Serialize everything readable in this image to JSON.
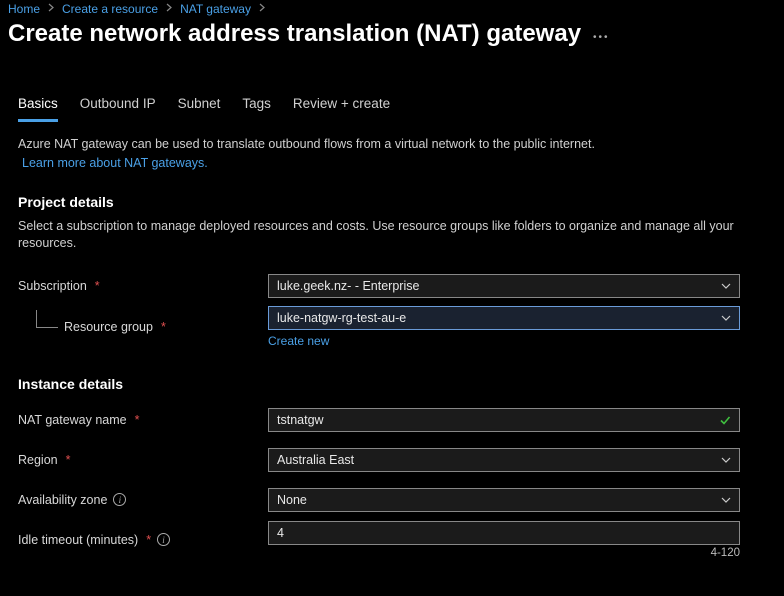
{
  "breadcrumb": {
    "home": "Home",
    "create": "Create a resource",
    "nat": "NAT gateway"
  },
  "page_title": "Create network address translation (NAT) gateway",
  "tabs": {
    "basics": "Basics",
    "outbound": "Outbound IP",
    "subnet": "Subnet",
    "tags": "Tags",
    "review": "Review + create"
  },
  "intro": {
    "text": "Azure NAT gateway can be used to translate outbound flows from a virtual network to the public internet.",
    "learn_more": "Learn more about NAT gateways."
  },
  "project": {
    "heading": "Project details",
    "desc": "Select a subscription to manage deployed resources and costs. Use resource groups like folders to organize and manage all your resources.",
    "subscription_label": "Subscription",
    "subscription_value": "luke.geek.nz- - Enterprise",
    "rg_label": "Resource group",
    "rg_value": "luke-natgw-rg-test-au-e",
    "create_new": "Create new"
  },
  "instance": {
    "heading": "Instance details",
    "name_label": "NAT gateway name",
    "name_value": "tstnatgw",
    "region_label": "Region",
    "region_value": "Australia East",
    "az_label": "Availability zone",
    "az_value": "None",
    "idle_label": "Idle timeout (minutes)",
    "idle_value": "4",
    "idle_range": "4-120"
  }
}
